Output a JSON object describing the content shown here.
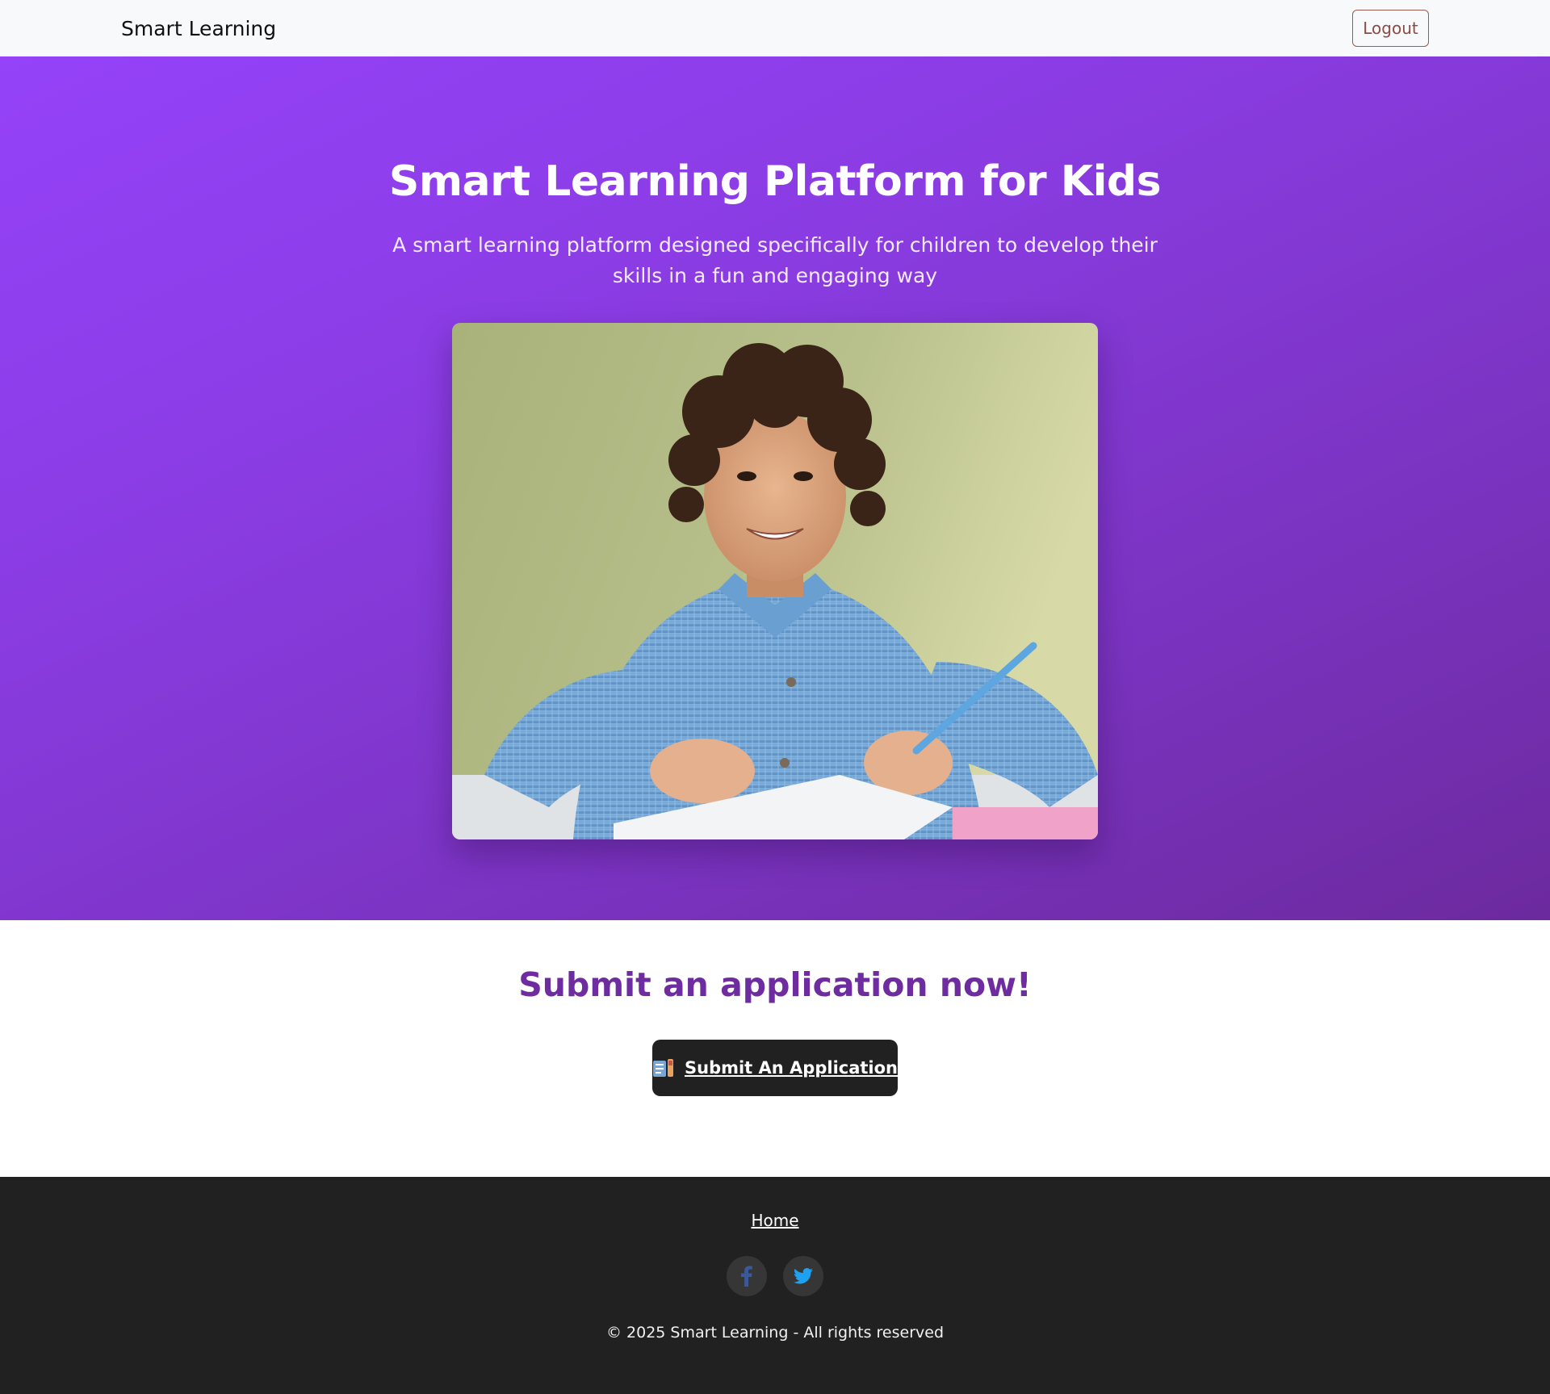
{
  "navbar": {
    "brand": "Smart Learning",
    "logout_label": "Logout"
  },
  "hero": {
    "title": "Smart Learning Platform for Kids",
    "subtitle": "A smart learning platform designed specifically for children to develop their skills in a fun and engaging way",
    "image_icon": "child-studying-photo"
  },
  "cta": {
    "title": "Submit an application now!",
    "button_label": "Submit An Application",
    "button_icon": "application-form-icon"
  },
  "footer": {
    "home_link": "Home",
    "social": [
      {
        "name": "facebook-icon",
        "color": "#3b5998"
      },
      {
        "name": "twitter-icon",
        "color": "#1da1f2"
      }
    ],
    "copyright": "© 2025 Smart Learning - All rights reserved"
  },
  "colors": {
    "hero_gradient_start": "#9542f9",
    "hero_gradient_end": "#6c2a9e",
    "cta_title": "#6f2ca0",
    "dark": "#212121",
    "logout_border": "#9c5a52"
  }
}
